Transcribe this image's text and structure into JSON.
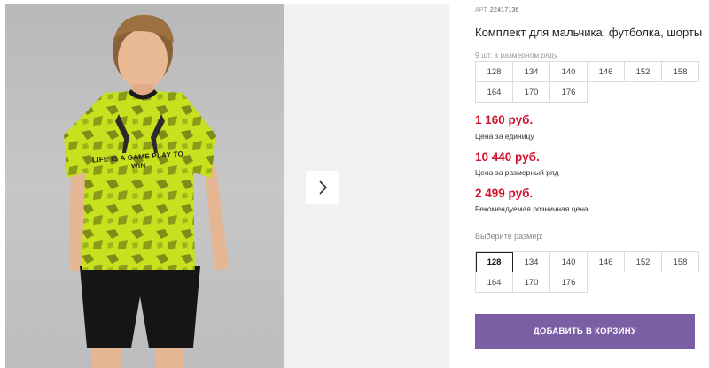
{
  "gallery": {
    "shirt_print_text": "LIFE IS A GAME PLAY TO WIN",
    "next_icon": "chevron-right-icon"
  },
  "product": {
    "article_label": "АРТ",
    "article_number": "22417136",
    "title": "Комплект для мальчика: футболка, шорты",
    "row_hint": "9 шт. в размерном ряду",
    "row_sizes": [
      "128",
      "134",
      "140",
      "146",
      "152",
      "158",
      "164",
      "170",
      "176"
    ],
    "prices": [
      {
        "value": "1 160 руб.",
        "label": "Цена за единицу"
      },
      {
        "value": "10 440 руб.",
        "label": "Цена за размерный ряд"
      },
      {
        "value": "2 499 руб.",
        "label": "Рекомендуемая розничная цена"
      }
    ],
    "choose_size_label": "Выберите размер:",
    "select_sizes": [
      "128",
      "134",
      "140",
      "146",
      "152",
      "158",
      "164",
      "170",
      "176"
    ],
    "selected_size": "128",
    "add_to_cart_label": "ДОБАВИТЬ В КОРЗИНУ"
  },
  "colors": {
    "price_red": "#d0142c",
    "button_purple": "#7b5ea3",
    "shirt_lime": "#c8e01e"
  }
}
